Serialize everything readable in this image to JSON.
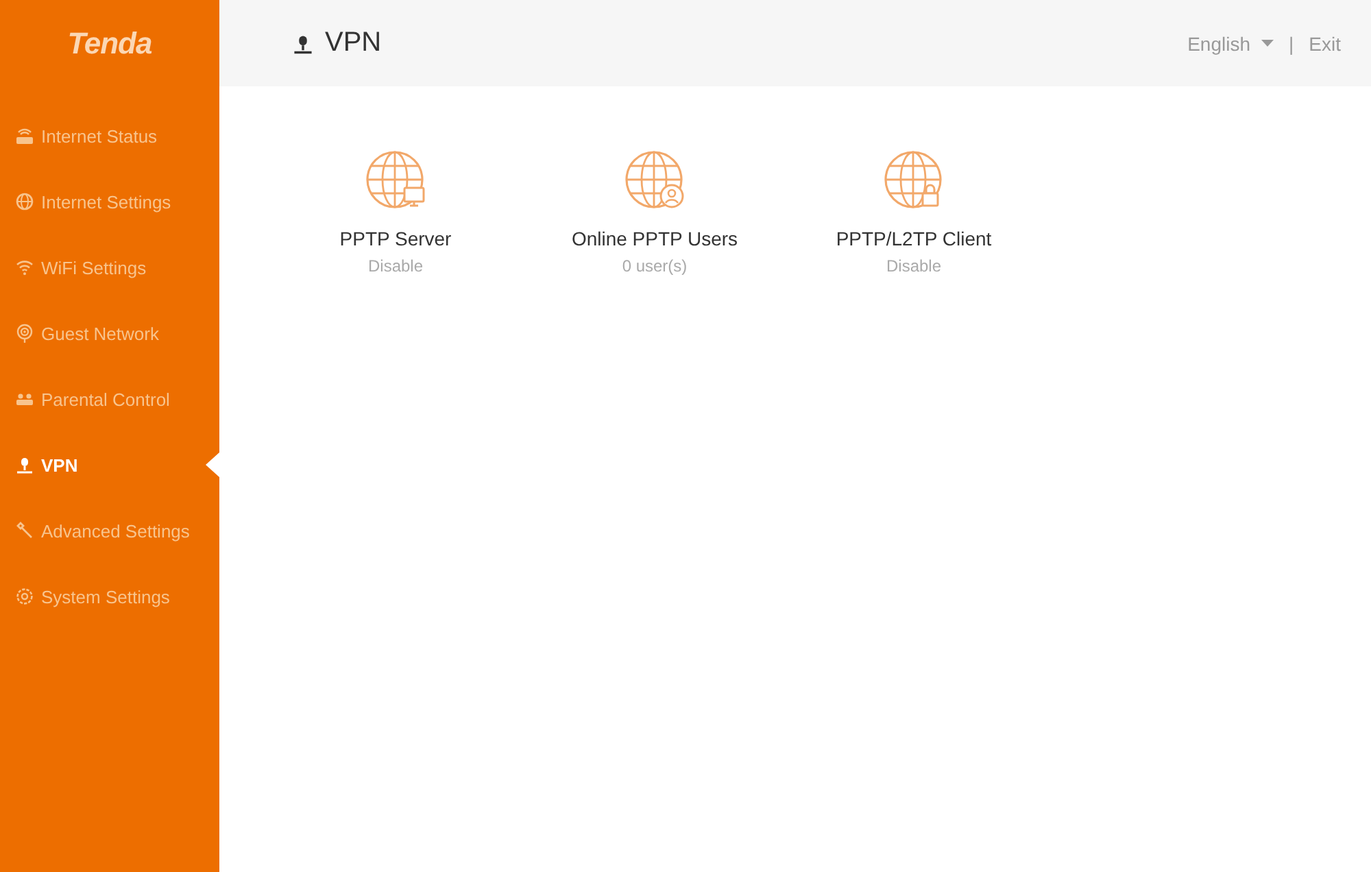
{
  "sidebar": {
    "logo": "Tenda",
    "items": [
      {
        "label": "Internet Status",
        "kind": "router",
        "selected": false
      },
      {
        "label": "Internet Settings",
        "kind": "globe",
        "selected": false
      },
      {
        "label": "WiFi Settings",
        "kind": "wifi",
        "selected": false
      },
      {
        "label": "Guest Network",
        "kind": "guest",
        "selected": false
      },
      {
        "label": "Parental Control",
        "kind": "parental",
        "selected": false
      },
      {
        "label": "VPN",
        "kind": "vpn",
        "selected": true
      },
      {
        "label": "Advanced Settings",
        "kind": "wrench",
        "selected": false
      },
      {
        "label": "System Settings",
        "kind": "gear",
        "selected": false
      }
    ]
  },
  "header": {
    "title": "VPN",
    "language": "English",
    "separator": "|",
    "exit": "Exit"
  },
  "cards": [
    {
      "title": "PPTP Server",
      "status": "Disable",
      "kind": "monitor"
    },
    {
      "title": "Online PPTP Users",
      "status": "0 user(s)",
      "kind": "user"
    },
    {
      "title": "PPTP/L2TP Client",
      "status": "Disable",
      "kind": "lock"
    }
  ]
}
